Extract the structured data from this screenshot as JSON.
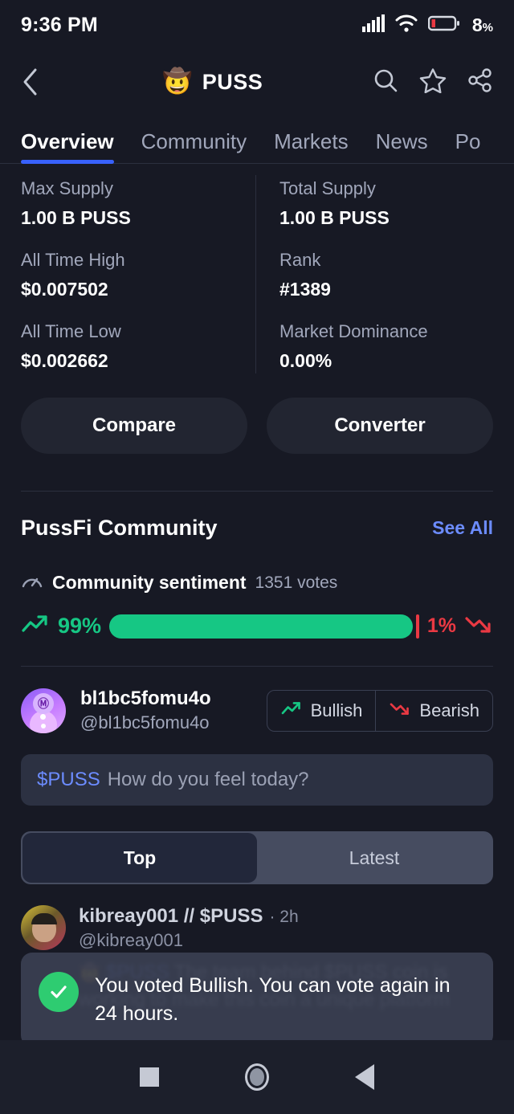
{
  "status_bar": {
    "time": "9:36 PM",
    "battery_percent": "8",
    "battery_unit": "%",
    "icons": [
      "cellular-signal-icon",
      "wifi-icon",
      "battery-icon"
    ]
  },
  "header": {
    "back_icon": "chevron-left-icon",
    "coin_logo_emoji": "🤠",
    "coin_symbol": "PUSS",
    "actions": [
      "search-icon",
      "star-icon",
      "share-icon"
    ]
  },
  "tabs": [
    {
      "label": "Overview",
      "active": true
    },
    {
      "label": "Community",
      "active": false
    },
    {
      "label": "Markets",
      "active": false
    },
    {
      "label": "News",
      "active": false
    },
    {
      "label": "Po",
      "active": false
    }
  ],
  "stats": {
    "left": [
      {
        "label": "Max Supply",
        "value": "1.00 B PUSS"
      },
      {
        "label": "All Time High",
        "value": "$0.007502"
      },
      {
        "label": "All Time Low",
        "value": "$0.002662"
      }
    ],
    "right": [
      {
        "label": "Total Supply",
        "value": "1.00 B PUSS"
      },
      {
        "label": "Rank",
        "value": "#1389"
      },
      {
        "label": "Market Dominance",
        "value": "0.00%"
      }
    ]
  },
  "actions": {
    "compare_label": "Compare",
    "converter_label": "Converter"
  },
  "community": {
    "section_title": "PussFi Community",
    "see_all_label": "See All",
    "sentiment": {
      "icon": "gauge-icon",
      "title": "Community sentiment",
      "votes_label": "1351 votes",
      "bullish_percent": "99%",
      "bearish_percent": "1%",
      "bullish_value": 99,
      "bearish_value": 1,
      "bullish_color": "#16c784",
      "bearish_color": "#ea3943"
    },
    "current_user": {
      "name": "bl1bc5fomu4o",
      "handle": "@bl1bc5fomu4o",
      "avatar_icon": "coinmarketcap-avatar"
    },
    "vote": {
      "bullish_label": "Bullish",
      "bullish_icon": "trend-up-icon",
      "bearish_label": "Bearish",
      "bearish_icon": "trend-down-icon"
    },
    "composer": {
      "cashtag": "$PUSS",
      "placeholder": "How do you feel today?"
    },
    "feed_filter": [
      {
        "label": "Top",
        "active": true
      },
      {
        "label": "Latest",
        "active": false
      }
    ],
    "posts": [
      {
        "name": "kibreay001 // $PUSS",
        "time": "· 2h",
        "handle": "@kibreay001",
        "emoji": "🤠",
        "cashtag": "$PUSS",
        "text": " The team behind $PUSS coin is working to make this coin a unique platform"
      }
    ]
  },
  "toast": {
    "icon": "check-circle-icon",
    "message": "You voted Bullish. You can vote again in 24 hours."
  },
  "navbar": {
    "items": [
      {
        "name": "recents-button",
        "icon": "square-icon"
      },
      {
        "name": "home-button",
        "icon": "circle-icon"
      },
      {
        "name": "back-button",
        "icon": "triangle-left-icon"
      }
    ]
  },
  "colors": {
    "background": "#171924",
    "surface": "#222531",
    "accent_blue": "#3861fb",
    "link_blue": "#6c8cff",
    "green": "#16c784",
    "red": "#ea3943",
    "muted_text": "#a1a7bb"
  }
}
